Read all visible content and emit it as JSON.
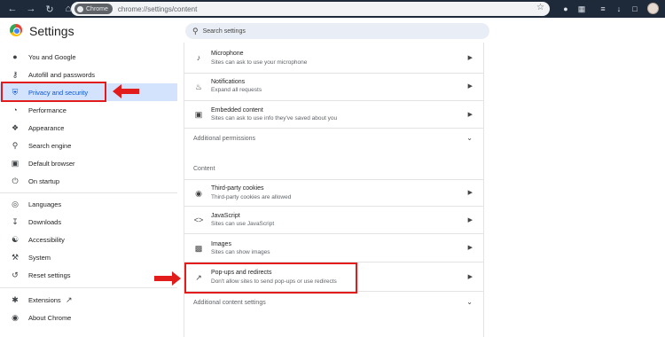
{
  "browser": {
    "chip_label": "Chrome",
    "url": "chrome://settings/content"
  },
  "app": {
    "title": "Settings"
  },
  "search": {
    "placeholder": "Search settings"
  },
  "sidebar": {
    "items": [
      {
        "label": "You and Google",
        "icon": "person-icon"
      },
      {
        "label": "Autofill and passwords",
        "icon": "key-icon"
      },
      {
        "label": "Privacy and security",
        "icon": "shield-icon",
        "active": true
      },
      {
        "label": "Performance",
        "icon": "speedometer-icon"
      },
      {
        "label": "Appearance",
        "icon": "palette-icon"
      },
      {
        "label": "Search engine",
        "icon": "search-icon"
      },
      {
        "label": "Default browser",
        "icon": "browser-icon"
      },
      {
        "label": "On startup",
        "icon": "power-icon"
      },
      {
        "label": "Languages",
        "icon": "globe-icon"
      },
      {
        "label": "Downloads",
        "icon": "download-icon"
      },
      {
        "label": "Accessibility",
        "icon": "accessibility-icon"
      },
      {
        "label": "System",
        "icon": "wrench-icon"
      },
      {
        "label": "Reset settings",
        "icon": "reset-icon"
      },
      {
        "label": "Extensions",
        "icon": "puzzle-icon"
      },
      {
        "label": "About Chrome",
        "icon": "chrome-icon"
      }
    ]
  },
  "content": {
    "permissions": [
      {
        "title": "Microphone",
        "subtitle": "Sites can ask to use your microphone",
        "icon": "microphone-icon"
      },
      {
        "title": "Notifications",
        "subtitle": "Expand all requests",
        "icon": "bell-icon"
      },
      {
        "title": "Embedded content",
        "subtitle": "Sites can ask to use info they've saved about you",
        "icon": "embedded-icon"
      }
    ],
    "additional_permissions": "Additional permissions",
    "section_title": "Content",
    "content_items": [
      {
        "title": "Third-party cookies",
        "subtitle": "Third-party cookies are allowed",
        "icon": "cookie-icon"
      },
      {
        "title": "JavaScript",
        "subtitle": "Sites can use JavaScript",
        "icon": "code-icon"
      },
      {
        "title": "Images",
        "subtitle": "Sites can show images",
        "icon": "image-icon"
      },
      {
        "title": "Pop-ups and redirects",
        "subtitle": "Don't allow sites to send pop-ups or use redirects",
        "icon": "popup-icon"
      }
    ],
    "additional_content": "Additional content settings"
  },
  "colors": {
    "accent": "#0b57d0",
    "highlight": "#e21b1b",
    "active_bg": "#d3e3fd"
  }
}
